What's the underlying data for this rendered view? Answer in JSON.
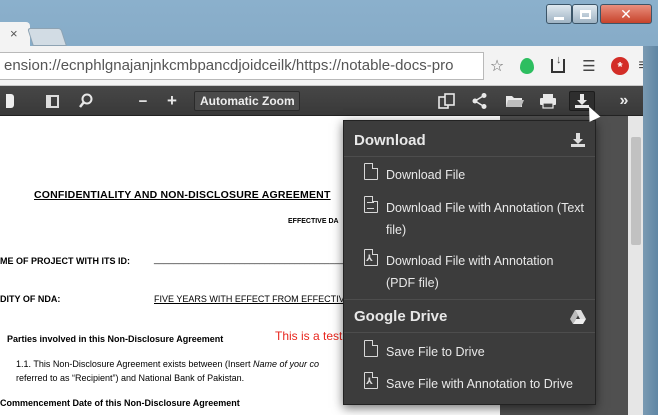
{
  "browser": {
    "address_bar": "ension://ecnphlgnajanjnkcmbpancdjoidceilk/https://notable-docs-pro",
    "icons": [
      "star-icon",
      "evernote-icon",
      "download-to-icon",
      "list-icon",
      "lastpass-icon",
      "menu-icon"
    ]
  },
  "pdf_toolbar": {
    "zoom_label": "Automatic Zoom",
    "zoom_caret": "♦",
    "minus": "−",
    "plus": "+"
  },
  "document": {
    "title": "CONFIDENTIALITY AND NON-DISCLOSURE AGREEMENT",
    "effective_date": "EFFECTIVE DA",
    "project_label": "ME OF PROJECT WITH ITS ID:",
    "project_value": "_______________________________________",
    "validity_label": "DITY OF NDA:",
    "validity_value": "FIVE YEARS WITH EFFECT FROM EFFECTIVE D",
    "parties_heading": "Parties involved in this Non-Disclosure Agreement",
    "annotation": "This is a test",
    "clause_1": "1.1. This Non-Disclosure Agreement exists between (Insert ",
    "clause_1_italic": "Name of your co",
    "clause_1b": "referred to as “Recipient”) and National Bank of Pakistan.",
    "commencement_heading": "Commencement Date of this Non-Disclosure Agreement"
  },
  "menu": {
    "download_header": "Download",
    "items_download": [
      {
        "label": "Download File",
        "kind": "file"
      },
      {
        "label": "Download File with Annotation (Text file)",
        "kind": "text"
      },
      {
        "label": "Download File with Annotation (PDF file)",
        "kind": "pdf"
      }
    ],
    "drive_header": "Google Drive",
    "items_drive": [
      {
        "label": "Save File to Drive",
        "kind": "file"
      },
      {
        "label": "Save File with Annotation to Drive",
        "kind": "pdf"
      }
    ]
  },
  "colors": {
    "annotation_red": "#e8261e",
    "menu_bg": "#3c3c3c",
    "toolbar_dark": "#404040"
  }
}
